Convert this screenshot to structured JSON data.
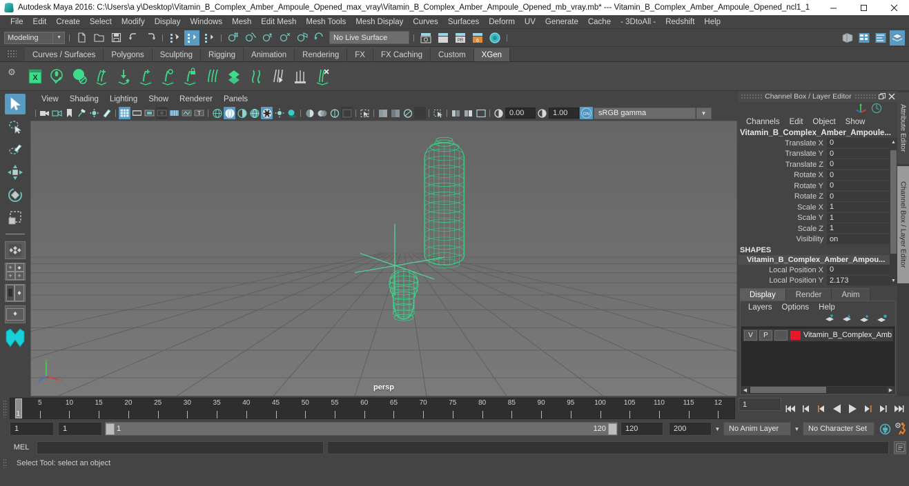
{
  "window": {
    "title": "Autodesk Maya 2016: C:\\Users\\a y\\Desktop\\Vitamin_B_Complex_Amber_Ampoule_Opened_max_vray\\Vitamin_B_Complex_Amber_Ampoule_Opened_mb_vray.mb*  ---  Vitamin_B_Complex_Amber_Ampoule_Opened_ncl1_1",
    "app_icon": "maya-logo-icon",
    "minimize": "minimize-icon",
    "maximize": "maximize-icon",
    "close": "close-icon"
  },
  "menubar": {
    "items": [
      "File",
      "Edit",
      "Create",
      "Select",
      "Modify",
      "Display",
      "Windows",
      "Mesh",
      "Edit Mesh",
      "Mesh Tools",
      "Mesh Display",
      "Curves",
      "Surfaces",
      "Deform",
      "UV",
      "Generate",
      "Cache",
      "- 3DtoAll -",
      "Redshift",
      "Help"
    ]
  },
  "statusline": {
    "menuset": "Modeling",
    "live_surface": "No Live Surface",
    "icons": [
      "new-scene-icon",
      "open-scene-icon",
      "save-scene-icon",
      "undo-icon",
      "redo-icon",
      "select-by-hierarchy-icon",
      "select-by-object-icon",
      "select-by-component-icon",
      "snap-to-grid-icon",
      "snap-to-curve-icon",
      "snap-to-point-icon",
      "snap-to-projected-center-icon",
      "snap-to-view-plane-icon",
      "make-live-icon"
    ],
    "right_icons": [
      "render-view-icon",
      "render-settings-icon",
      "hypershade-icon",
      "render-sequence-icon"
    ],
    "editor_icons": [
      "show-hide-attribute-editor-icon",
      "show-hide-tool-settings-icon",
      "show-hide-channel-box-icon",
      "show-hide-layer-editor-icon"
    ]
  },
  "shelf": {
    "tabs": [
      "Curves / Surfaces",
      "Polygons",
      "Sculpting",
      "Rigging",
      "Animation",
      "Rendering",
      "FX",
      "FX Caching",
      "Custom",
      "XGen"
    ],
    "active_tab": "XGen",
    "icons": [
      "xgen-editor-icon",
      "create-description-icon",
      "create-collection-icon",
      "add-guides-icon",
      "place-guides-icon",
      "groom-add-icon",
      "groom-density-icon",
      "groom-lock-icon",
      "groom-comb-icon",
      "groom-clump-icon",
      "groom-noise-icon",
      "groom-cut-icon",
      "groom-scale-icon",
      "groom-remove-icon"
    ]
  },
  "toolbox": {
    "tools": [
      {
        "name": "select-tool",
        "active": true
      },
      {
        "name": "lasso-select-tool",
        "active": false
      },
      {
        "name": "paint-select-tool",
        "active": false
      },
      {
        "name": "move-tool",
        "active": false
      },
      {
        "name": "rotate-tool",
        "active": false
      },
      {
        "name": "scale-tool",
        "active": false
      }
    ],
    "layouts": [
      "single-perspective-layout",
      "four-view-layout",
      "outliner-persp-layout",
      "persp-graph-layout"
    ]
  },
  "viewport": {
    "menus": [
      "View",
      "Shading",
      "Lighting",
      "Show",
      "Renderer",
      "Panels"
    ],
    "camera_label": "persp",
    "exposure": "0.00",
    "gamma": "1.00",
    "color_management": "sRGB gamma",
    "view_toggle": "ON",
    "toolbar_icons": [
      "select-camera-icon",
      "camera-attributes-icon",
      "bookmark-icon",
      "image-plane-icon",
      "2d-pan-zoom-icon",
      "grease-pencil-icon",
      "grid-toggle-icon",
      "film-gate-icon",
      "resolution-gate-icon",
      "gate-mask-icon",
      "film-origin-icon",
      "field-chart-icon",
      "safe-title-icon",
      "wireframe-icon",
      "smooth-shade-all-icon",
      "shade-selected-icon",
      "wireframe-on-shaded-icon",
      "texture-toggle-icon",
      "use-all-lights-icon",
      "shadows-icon",
      "screen-space-ao-icon",
      "motion-blur-icon",
      "multisample-icon",
      "depth-of-field-icon",
      "isolate-select-icon",
      "xray-icon",
      "xray-joints-icon",
      "xray-active-components-icon"
    ]
  },
  "channel_box": {
    "panel_title": "Channel Box / Layer Editor",
    "undock_icon": "undock-icon",
    "close_icon": "close-icon",
    "header_icons": [
      "manipulator-icon",
      "scene-toggle-icon"
    ],
    "menus": [
      "Channels",
      "Edit",
      "Object",
      "Show"
    ],
    "object_name": "Vitamin_B_Complex_Amber_Ampoule...",
    "channels": [
      {
        "label": "Translate X",
        "value": "0"
      },
      {
        "label": "Translate Y",
        "value": "0"
      },
      {
        "label": "Translate Z",
        "value": "0"
      },
      {
        "label": "Rotate X",
        "value": "0"
      },
      {
        "label": "Rotate Y",
        "value": "0"
      },
      {
        "label": "Rotate Z",
        "value": "0"
      },
      {
        "label": "Scale X",
        "value": "1"
      },
      {
        "label": "Scale Y",
        "value": "1"
      },
      {
        "label": "Scale Z",
        "value": "1"
      },
      {
        "label": "Visibility",
        "value": "on"
      }
    ],
    "shapes_header": "SHAPES",
    "shape_name": "Vitamin_B_Complex_Amber_Ampou...",
    "shape_channels": [
      {
        "label": "Local Position X",
        "value": "0"
      },
      {
        "label": "Local Position Y",
        "value": "2.173"
      }
    ]
  },
  "layer_editor": {
    "tabs": [
      "Display",
      "Render",
      "Anim"
    ],
    "active_tab": "Display",
    "menus": [
      "Layers",
      "Options",
      "Help"
    ],
    "buttons": [
      "move-layer-up-icon",
      "move-layer-down-icon",
      "create-new-layer-icon",
      "create-layer-from-selected-icon"
    ],
    "layers": [
      {
        "visibility": "V",
        "playback": "P",
        "type": "",
        "color": "#e8172b",
        "name": "Vitamin_B_Complex_Amb"
      }
    ]
  },
  "side_tabs": {
    "items": [
      "Attribute Editor",
      "Channel Box / Layer Editor"
    ],
    "active": "Channel Box / Layer Editor"
  },
  "time_slider": {
    "current_frame": "1",
    "tick_labels": [
      "5",
      "10",
      "15",
      "20",
      "25",
      "30",
      "35",
      "40",
      "45",
      "50",
      "55",
      "60",
      "65",
      "70",
      "75",
      "80",
      "85",
      "90",
      "95",
      "100",
      "105",
      "110",
      "115",
      "12"
    ],
    "frame_field": "1",
    "playback_buttons": [
      "go-to-start-icon",
      "step-back-key-icon",
      "step-back-frame-icon",
      "play-backwards-icon",
      "play-forwards-icon",
      "step-forward-frame-icon",
      "step-forward-key-icon",
      "go-to-end-icon"
    ]
  },
  "range_slider": {
    "anim_start": "1",
    "range_start": "1",
    "bar_start": "1",
    "bar_end": "120",
    "range_end": "120",
    "anim_end": "200",
    "anim_layer": "No Anim Layer",
    "character_set": "No Character Set",
    "auto_key_icon": "auto-keyframe-icon",
    "anim_prefs_icon": "animation-preferences-icon"
  },
  "command_line": {
    "label": "MEL",
    "input_value": "",
    "input_placeholder": "",
    "output_value": "",
    "script_editor_icon": "script-editor-icon"
  },
  "help_line": {
    "text": "Select Tool: select an object"
  },
  "colors": {
    "accent_blue": "#5a9bc4",
    "wireframe_green": "#2ee68c",
    "layer_red": "#e8172b",
    "panel_bg": "#444444",
    "viewport_bg": "#6f6f6f"
  }
}
